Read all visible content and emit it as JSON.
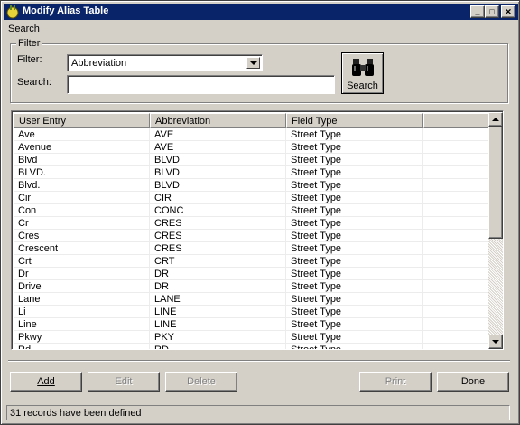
{
  "window": {
    "title": "Modify Alias Table"
  },
  "menu": {
    "search": "Search"
  },
  "filter": {
    "group_label": "Filter",
    "filter_label": "Filter:",
    "filter_value": "Abbreviation",
    "search_label": "Search:",
    "search_value": "",
    "search_button": "Search"
  },
  "table": {
    "columns": [
      "User Entry",
      "Abbreviation",
      "Field Type"
    ],
    "rows": [
      [
        "Ave",
        "AVE",
        "Street Type"
      ],
      [
        "Avenue",
        "AVE",
        "Street Type"
      ],
      [
        "Blvd",
        "BLVD",
        "Street Type"
      ],
      [
        "BLVD.",
        "BLVD",
        "Street Type"
      ],
      [
        "Blvd.",
        "BLVD",
        "Street Type"
      ],
      [
        "Cir",
        "CIR",
        "Street Type"
      ],
      [
        "Con",
        "CONC",
        "Street Type"
      ],
      [
        "Cr",
        "CRES",
        "Street Type"
      ],
      [
        "Cres",
        "CRES",
        "Street Type"
      ],
      [
        "Crescent",
        "CRES",
        "Street Type"
      ],
      [
        "Crt",
        "CRT",
        "Street Type"
      ],
      [
        "Dr",
        "DR",
        "Street Type"
      ],
      [
        "Drive",
        "DR",
        "Street Type"
      ],
      [
        "Lane",
        "LANE",
        "Street Type"
      ],
      [
        "Li",
        "LINE",
        "Street Type"
      ],
      [
        "Line",
        "LINE",
        "Street Type"
      ],
      [
        "Pkwy",
        "PKY",
        "Street Type"
      ],
      [
        "Rd",
        "RD",
        "Street Type"
      ]
    ]
  },
  "buttons": {
    "add": "Add",
    "edit": "Edit",
    "delete": "Delete",
    "print": "Print",
    "done": "Done"
  },
  "status": {
    "text": "31 records have been defined"
  },
  "colors": {
    "titlebar": "#0a246a",
    "face": "#d4d0c8",
    "disabled_text": "#808080"
  }
}
